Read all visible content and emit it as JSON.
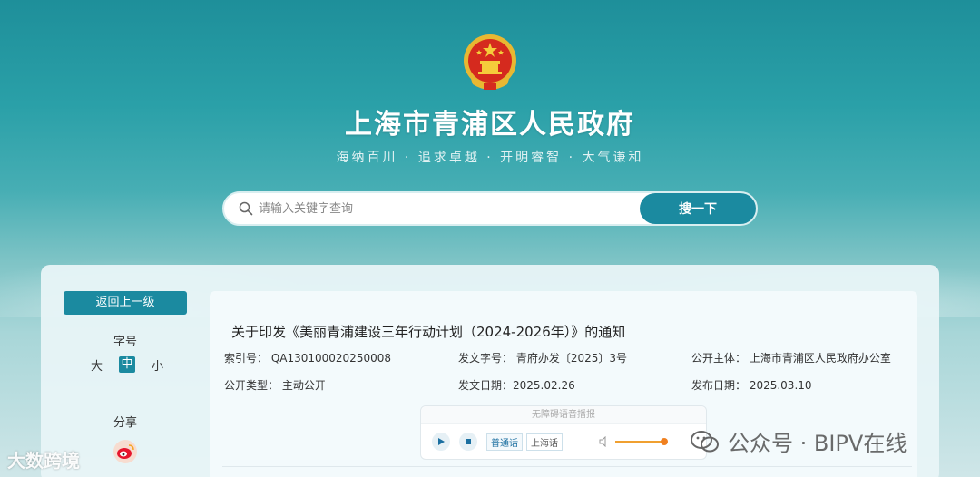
{
  "header": {
    "site_title": "上海市青浦区人民政府",
    "slogan": "海纳百川 · 追求卓越 · 开明睿智 · 大气谦和"
  },
  "search": {
    "placeholder": "请输入关键字查询",
    "button_label": "搜一下"
  },
  "sidebar": {
    "back_label": "返回上一级",
    "font_label": "字号",
    "font_sizes": [
      "大",
      "中",
      "小"
    ],
    "share_label": "分享"
  },
  "document": {
    "title": "关于印发《美丽青浦建设三年行动计划（2024-2026年）》的通知",
    "meta": {
      "index_no": "索引号：  QA130100020250008",
      "doc_no": "发文字号：  青府办发〔2025〕3号",
      "publisher": "公开主体：  上海市青浦区人民政府办公室",
      "open_type": "公开类型：  主动公开",
      "issue_date": "发文日期：2025.02.26",
      "publish_date": "发布日期：  2025.03.10"
    }
  },
  "audio": {
    "header": "无障碍语音播报",
    "langs": [
      "普通话",
      "上海话"
    ]
  },
  "watermarks": {
    "left": "大数跨境",
    "right": "公众号 · BIPV在线"
  },
  "colors": {
    "accent": "#1b8aa0",
    "background": "#2aa0a8"
  }
}
